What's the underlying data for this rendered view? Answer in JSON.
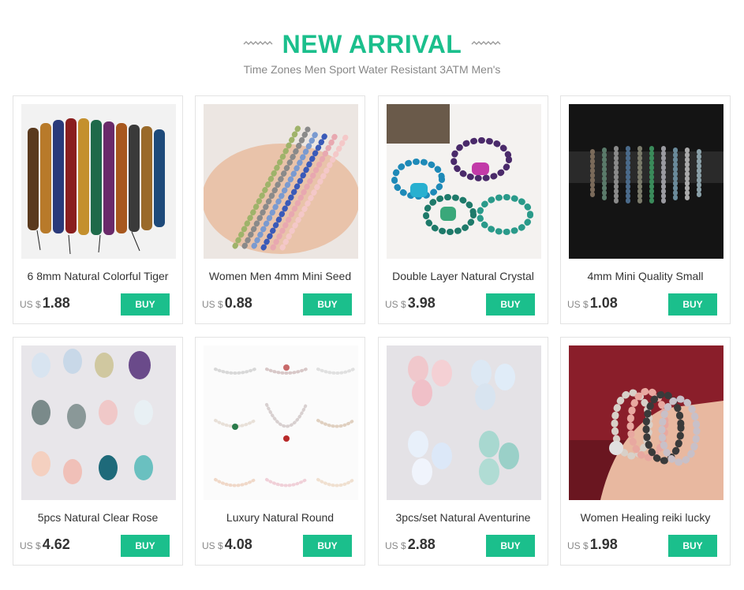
{
  "header": {
    "title": "NEW ARRIVAL",
    "subtitle": "Time Zones Men Sport Water Resistant 3ATM Men's"
  },
  "products": [
    {
      "name": "6 8mm Natural Colorful Tiger",
      "currency": "US $",
      "price": "1.88",
      "buy": "BUY"
    },
    {
      "name": "Women Men 4mm Mini Seed",
      "currency": "US $",
      "price": "0.88",
      "buy": "BUY"
    },
    {
      "name": "Double Layer Natural Crystal",
      "currency": "US $",
      "price": "3.98",
      "buy": "BUY"
    },
    {
      "name": "4mm Mini Quality Small",
      "currency": "US $",
      "price": "1.08",
      "buy": "BUY"
    },
    {
      "name": "5pcs Natural Clear Rose",
      "currency": "US $",
      "price": "4.62",
      "buy": "BUY"
    },
    {
      "name": "Luxury Natural Round",
      "currency": "US $",
      "price": "4.08",
      "buy": "BUY"
    },
    {
      "name": "3pcs/set Natural Aventurine",
      "currency": "US $",
      "price": "2.88",
      "buy": "BUY"
    },
    {
      "name": "Women Healing reiki lucky",
      "currency": "US $",
      "price": "1.98",
      "buy": "BUY"
    }
  ],
  "colors": {
    "accent": "#1bbf8c"
  }
}
